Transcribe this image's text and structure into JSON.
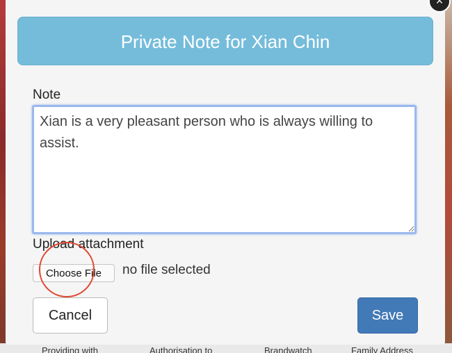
{
  "modal": {
    "title": "Private Note for Xian Chin",
    "close_icon": "×",
    "note_label": "Note",
    "note_value": "Xian is a very pleasant person who is always willing to assist.",
    "upload_label": "Upload attachment",
    "choose_file_label": "Choose File",
    "file_status": "no file selected",
    "cancel_label": "Cancel",
    "save_label": "Save"
  },
  "backdrop": {
    "fragments": [
      "Providing with",
      "Authorisation to",
      "Brandwatch",
      "Family Address"
    ]
  },
  "colors": {
    "header_bg": "#75bcdb",
    "save_bg": "#4279b7",
    "highlight_circle": "#e0452e",
    "textarea_focus": "#9bb8ec"
  }
}
